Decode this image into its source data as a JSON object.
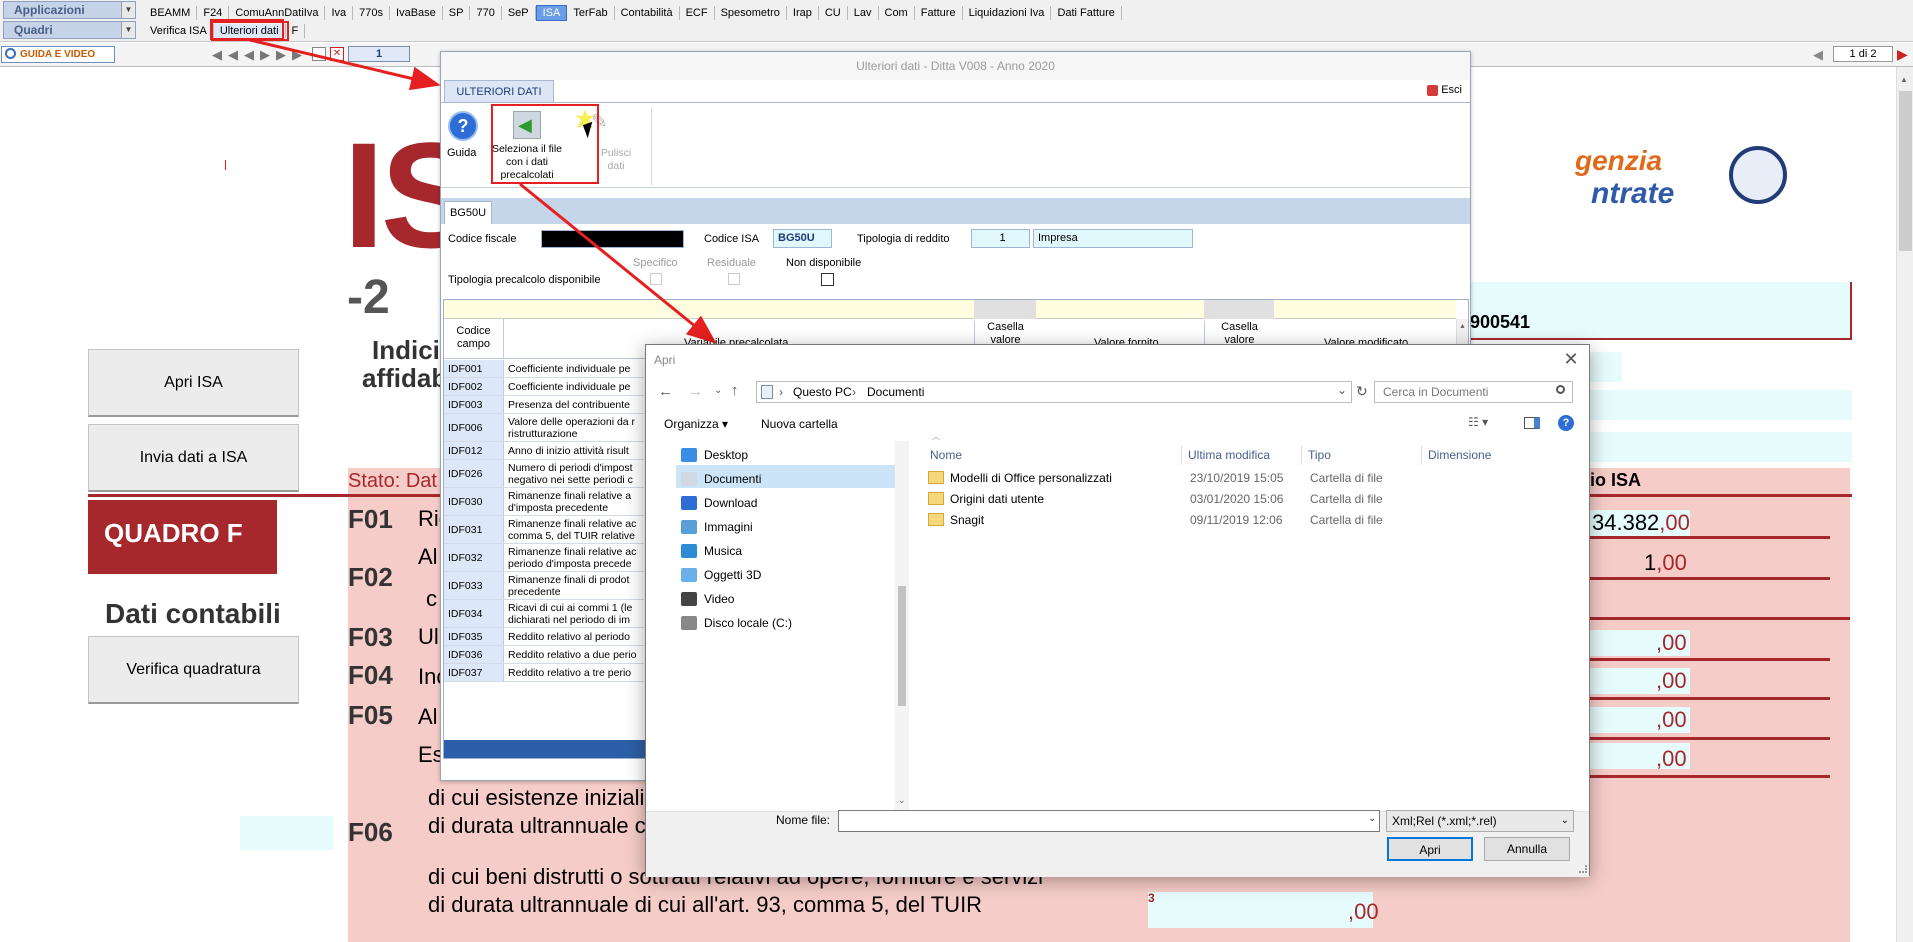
{
  "menu": {
    "row1_combo": "Applicazioni",
    "row2_combo": "Quadri",
    "row1_items": [
      "BEAMM",
      "F24",
      "ComuAnnDatiIva",
      "Iva",
      "770s",
      "IvaBase",
      "SP",
      "770",
      "SeP",
      "ISA",
      "TerFab",
      "Contabilità",
      "ECF",
      "Spesometro",
      "Irap",
      "CU",
      "Lav",
      "Com",
      "Fatture",
      "Liquidazioni Iva",
      "Dati Fatture"
    ],
    "row2_items": [
      "Verifica ISA",
      "Ulteriori dati",
      "F"
    ],
    "active_row1": "ISA",
    "active_row2": "Ulteriori dati"
  },
  "nav": {
    "guida_label": "GUIDA E VIDEO",
    "page_input": "1",
    "page_count": "1 di 2"
  },
  "background_form": {
    "buttons": [
      "Apri ISA",
      "Invia dati a ISA",
      "Verifica quadratura"
    ],
    "logo_partial": "ISA",
    "year_partial": "-2",
    "indici_partial": [
      "Indici",
      "affidab"
    ],
    "stato_label": "Stato: Dat",
    "quadro_title": "QUADRO F",
    "dati_contabili": "Dati contabili",
    "agency_logo_line1": "genzia",
    "agency_logo_line2": "ntrate",
    "codice_partial": "900541",
    "invio_partial": "vio ISA",
    "row_codes": [
      "F01",
      "F02",
      "F03",
      "F04",
      "F05",
      "F06"
    ],
    "row_texts": [
      "Ric",
      "Al",
      "c",
      "Ul",
      "Inc",
      "Al",
      "Es"
    ],
    "f06_lines": [
      "di cui esistenze iniziali",
      "di durata ultrannuale c",
      "di cui beni distrutti o sottratti relativi ad opere, forniture e servizi",
      "di durata ultrannuale di cui all'art. 93, comma 5, del TUIR"
    ],
    "amounts": [
      {
        "int": "34.382",
        "dec": ",00"
      },
      {
        "int": "1",
        "dec": ",00"
      },
      {
        "int": "",
        "dec": ",00"
      },
      {
        "int": "",
        "dec": ",00"
      },
      {
        "int": "",
        "dec": ",00"
      },
      {
        "int": "",
        "dec": ",00"
      },
      {
        "int": "",
        "dec": ",00"
      }
    ],
    "field_number": "3"
  },
  "ulteriori_dialog": {
    "title": "Ulteriori dati - Ditta V008 - Anno 2020",
    "tab": "ULTERIORI DATI",
    "exit_label": "Esci",
    "ribbon": {
      "guida": "Guida",
      "seleziona": "Seleziona il file con i dati precalcolati",
      "pulisci": "Pulisci dati"
    },
    "subtab": "BG50U",
    "codice_fiscale_label": "Codice fiscale",
    "codice_isa_label": "Codice ISA",
    "codice_isa_value": "BG50U",
    "tipologia_label": "Tipologia di reddito",
    "tipologia_code": "1",
    "tipologia_value": "Impresa",
    "precalcolo_label": "Tipologia precalcolo disponibile",
    "checks": [
      "Specifico",
      "Residuale",
      "Non disponibile"
    ],
    "grid_headers": [
      "Codice campo",
      "Variabile precalcolata",
      "Casella valore",
      "Valore fornito",
      "Casella valore",
      "Valore modificato"
    ],
    "rows": [
      {
        "code": "IDF001",
        "text": "Coefficiente individuale pe"
      },
      {
        "code": "IDF002",
        "text": "Coefficiente individuale pe"
      },
      {
        "code": "IDF003",
        "text": "Presenza del contribuente"
      },
      {
        "code": "IDF006",
        "text": "Valore delle operazioni da r ristrutturazione"
      },
      {
        "code": "IDF012",
        "text": "Anno di inizio attività risult"
      },
      {
        "code": "IDF026",
        "text": "Numero di periodi d'impost negativo nei sette periodi c"
      },
      {
        "code": "IDF030",
        "text": "Rimanenze finali relative a d'imposta precedente"
      },
      {
        "code": "IDF031",
        "text": "Rimanenze finali relative ac comma 5, del TUIR relative"
      },
      {
        "code": "IDF032",
        "text": "Rimanenze finali relative ac periodo d'imposta precede"
      },
      {
        "code": "IDF033",
        "text": "Rimanenze finali di prodot precedente"
      },
      {
        "code": "IDF034",
        "text": "Ricavi di cui ai commi 1 (le dichiarati nel periodo di im"
      },
      {
        "code": "IDF035",
        "text": "Reddito relativo al periodo"
      },
      {
        "code": "IDF036",
        "text": "Reddito relativo a due perio"
      },
      {
        "code": "IDF037",
        "text": "Reddito relativo a tre perio"
      }
    ]
  },
  "apri_dialog": {
    "title": "Apri",
    "breadcrumb": [
      "Questo PC",
      "Documenti"
    ],
    "search_placeholder": "Cerca in Documenti",
    "toolbar": {
      "organizza": "Organizza",
      "nuova_cartella": "Nuova cartella"
    },
    "nav_items": [
      "Desktop",
      "Documenti",
      "Download",
      "Immagini",
      "Musica",
      "Oggetti 3D",
      "Video",
      "Disco locale (C:)"
    ],
    "nav_selected": "Documenti",
    "columns": [
      "Nome",
      "Ultima modifica",
      "Tipo",
      "Dimensione"
    ],
    "files": [
      {
        "name": "Modelli di Office personalizzati",
        "date": "23/10/2019 15:05",
        "type": "Cartella di file"
      },
      {
        "name": "Origini dati utente",
        "date": "03/01/2020 15:06",
        "type": "Cartella di file"
      },
      {
        "name": "Snagit",
        "date": "09/11/2019 12:06",
        "type": "Cartella di file"
      }
    ],
    "filename_label": "Nome file:",
    "filename_value": "",
    "filter": "Xml;Rel (*.xml;*.rel)",
    "open_button": "Apri",
    "cancel_button": "Annulla"
  },
  "colors": {
    "accent_red": "#a6282d",
    "highlight": "#e52020",
    "selection": "#cce4f7"
  }
}
